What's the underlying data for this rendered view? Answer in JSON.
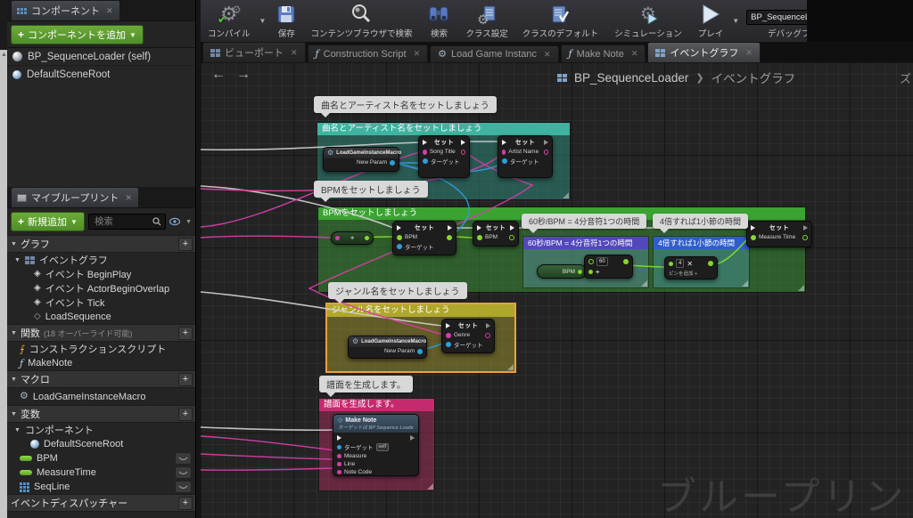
{
  "app": {
    "watermark": "ブループリント",
    "zoom_indicator": "ズ"
  },
  "colors": {
    "accent_green": "#5f9e2f",
    "comment_teal": "#3fb3a0",
    "comment_green": "#3aa332",
    "comment_purple": "#5347bd",
    "comment_blue": "#2f5ecc",
    "comment_yellow": "#c9bd2e",
    "comment_pink": "#c62a6e",
    "pin_pink": "#d63fa8",
    "pin_blue": "#2f9fd8",
    "pin_green": "#84d92c"
  },
  "components_panel": {
    "tab_title": "コンポーネント",
    "add_button": "コンポーネントを追加",
    "items": {
      "root": "BP_SequenceLoader (self)",
      "scene_root": "DefaultSceneRoot"
    }
  },
  "toolbar": {
    "compile": "コンパイル",
    "save": "保存",
    "find_in_cb": "コンテンツブラウザで検索",
    "search": "検索",
    "class_settings": "クラス設定",
    "class_defaults": "クラスのデフォルト",
    "simulate": "シミュレーション",
    "play": "プレイ",
    "debug_value": "BP_SequenceLoader",
    "debug_label": "デバッグフィルター"
  },
  "doc_tabs": {
    "viewport": "ビューポート",
    "construction": "Construction Script",
    "load_game": "Load Game Instanc",
    "make_note": "Make Note",
    "event_graph": "イベントグラフ"
  },
  "breadcrumb": {
    "root": "BP_SequenceLoader",
    "current": "イベントグラフ"
  },
  "my_blueprint": {
    "tab_title": "マイブループリント",
    "add_button": "新規追加",
    "search_placeholder": "検索",
    "sections": {
      "graph": "グラフ",
      "functions": "関数",
      "functions_note": "(18 オーバーライド可能)",
      "macros": "マクロ",
      "variables": "変数",
      "dispatchers": "イベントディスパッチャー"
    },
    "graph_items": {
      "event_graph": "イベントグラフ",
      "begin_play": "イベント BeginPlay",
      "actor_overlap": "イベント ActorBeginOverlap",
      "tick": "イベント Tick",
      "load_sequence": "LoadSequence"
    },
    "function_items": {
      "construction": "コンストラクションスクリプト",
      "make_note": "MakeNote"
    },
    "macro_items": {
      "lgim": "LoadGameInstanceMacro"
    },
    "variable_groups": {
      "components": "コンポーネント"
    },
    "variable_items": {
      "default_scene_root": "DefaultSceneRoot",
      "bpm": "BPM",
      "measure_time": "MeasureTime",
      "seq_line": "SeqLine"
    }
  },
  "graph": {
    "comments": {
      "song": {
        "title": "曲名とアーティスト名をセットしましょう",
        "bubble": "曲名とアーティスト名をセットしましょう"
      },
      "bpm": {
        "title": "BPMをセットしましょう",
        "bubble": "BPMをセットしましょう"
      },
      "sixty": {
        "title": "60秒/BPM = 4分音符1つの時間",
        "bubble": "60秒/BPM = 4分音符1つの時間"
      },
      "four": {
        "title": "4倍すれば1小節の時間",
        "bubble": "4倍すれば1小節の時間"
      },
      "genre": {
        "title": "ジャンル名をセットしましょう",
        "bubble": "ジャンル名をセットしましょう"
      },
      "score": {
        "title": "譜面を生成します。",
        "bubble": "譜面を生成します。"
      }
    },
    "nodes": {
      "set_label": "セット",
      "macro_title": "LoadGameInstanceMacro",
      "macro_pin": "New Param",
      "song_title_pin": "Song Title",
      "artist_pin": "Artist Name",
      "target_pin": "ターゲット",
      "bpm_pin": "BPM",
      "measure_time_pin": "Measure Time",
      "divide_value": "60",
      "divide_op": "÷",
      "multiply_value": "4",
      "multiply_op": "✕",
      "add_pin_label": "ピンを追加 +",
      "genre_pin": "Genre",
      "make_note": {
        "title": "Make Note",
        "subtitle": "ターゲットは BP Sequence Loade",
        "target": "ターゲット",
        "self_tag": "self",
        "measure": "Measure",
        "line": "Line",
        "note_code": "Note Code"
      }
    }
  }
}
